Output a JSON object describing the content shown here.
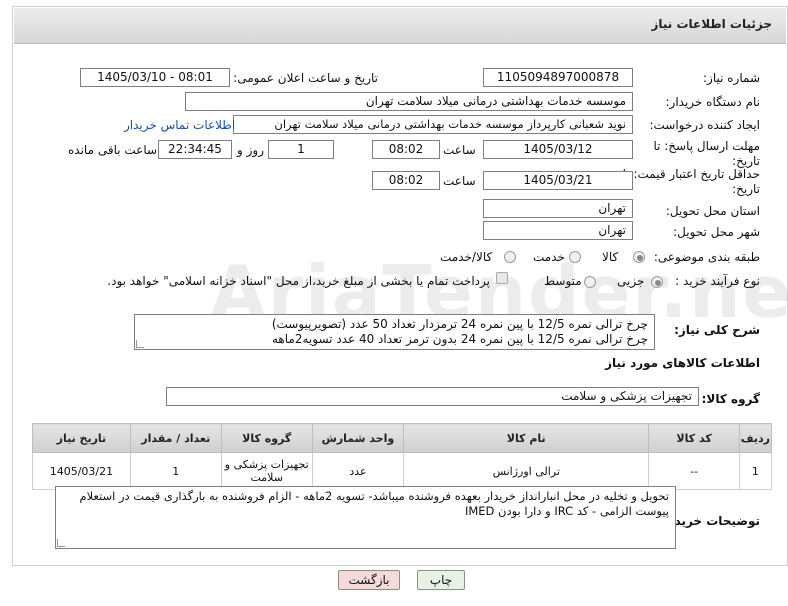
{
  "header": {
    "title": "جزئیات اطلاعات نیاز"
  },
  "fields": {
    "need_number_label": "شماره نیاز:",
    "need_number": "1105094897000878",
    "announce_label": "تاریخ و ساعت اعلان عمومی:",
    "announce_value": "1405/03/10 - 08:01",
    "buyer_org_label": "نام دستگاه خریدار:",
    "buyer_org": "موسسه خدمات بهداشتی درمانی میلاد سلامت تهران",
    "requester_label": "ایجاد کننده درخواست:",
    "requester": "نوید شعبانی کارپرداز موسسه خدمات بهداشتی درمانی میلاد سلامت تهران",
    "contact_link": "اطلاعات تماس خریدار",
    "deadline_label": "مهلت ارسال پاسخ: تا تاریخ:",
    "deadline_date": "1405/03/12",
    "time_label": "ساعت",
    "deadline_time": "08:02",
    "days_value": "1",
    "days_label": "روز و",
    "remaining_time": "22:34:45",
    "remaining_label": "ساعت باقی مانده",
    "validity_label": "حداقل تاریخ اعتبار قیمت: تا تاریخ:",
    "validity_date": "1405/03/21",
    "validity_time": "08:02",
    "province_label": "استان محل تحویل:",
    "province": "تهران",
    "city_label": "شهر محل تحویل:",
    "city": "تهران",
    "category_label": "طبقه بندی موضوعی:",
    "category_options": [
      "کالا",
      "خدمت",
      "کالا/خدمت"
    ],
    "process_label": "نوع فرآیند خرید :",
    "process_options": [
      "جزیی",
      "متوسط"
    ],
    "payment_note": "پرداخت تمام یا بخشی از مبلغ خرید،از محل \"اسناد خزانه اسلامی\" خواهد بود."
  },
  "description": {
    "label": "شرح کلی نیاز:",
    "lines": [
      "چرخ ترالی نمره 12/5 با پین نمره 24 ترمزدار  تعداد 50 عدد (تصویرپیوست)",
      "چرخ ترالی نمره 12/5 با پین نمره 24 بدون ترمز   تعداد 40 عدد  تسویه2ماهه"
    ]
  },
  "goods": {
    "section_title": "اطلاعات کالاهای مورد نیاز",
    "group_label": "گروه کالا:",
    "group_value": "تجهیزات پزشکی و سلامت",
    "columns": [
      "ردیف",
      "کد کالا",
      "نام کالا",
      "واحد شمارش",
      "گروه کالا",
      "تعداد / مقدار",
      "تاریخ نیاز"
    ],
    "rows": [
      {
        "row": "1",
        "code": "--",
        "name": "ترالی اورژانس",
        "unit": "عدد",
        "group": "تجهیزات پزشکی و سلامت",
        "qty": "1",
        "date": "1405/03/21"
      }
    ]
  },
  "buyer_notes": {
    "label": "توضیحات خریدار:",
    "lines": [
      "تحویل و تخلیه در محل انبارانداز خریدار بعهده فروشنده میباشد- تسویه 2ماهه - الزام فروشنده به بارگذاری قیمت در استعلام",
      "پیوست الزامی - کد IRC و دارا بودن IMED"
    ]
  },
  "buttons": {
    "print": "چاپ",
    "back": "بازگشت"
  },
  "watermark": "AriaTender.neT",
  "colors": {
    "link": "#1e50a0",
    "back_button_bg": "#f6d9d9",
    "print_button_bg": "#e8f2e3"
  }
}
